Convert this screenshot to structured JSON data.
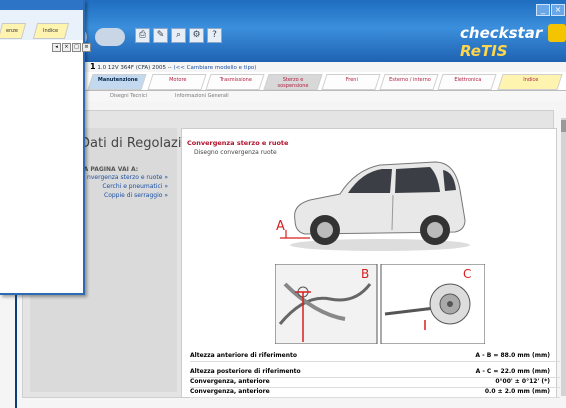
{
  "app": {
    "logo_text": "checkstar",
    "logo_suffix": "ReTIS",
    "vehicle_model": "1",
    "vehicle_desc": "1.0 12V 364F (CFA) 2005 --",
    "change_link": "(<< Cambiare modello e tipo)"
  },
  "main_tabs": [
    {
      "label": "Manutenzione",
      "state": "active"
    },
    {
      "label": "Motore",
      "state": "normal"
    },
    {
      "label": "Trasmissione",
      "state": "normal"
    },
    {
      "label": "Sterzo e sospensione",
      "state": "gray"
    },
    {
      "label": "Freni",
      "state": "normal"
    },
    {
      "label": "Esterno / interno",
      "state": "normal"
    },
    {
      "label": "Elettronica",
      "state": "normal"
    },
    {
      "label": "Indice",
      "state": "last"
    }
  ],
  "sub_tabs": [
    "Disegni Tecnici",
    "Informazioni Generali"
  ],
  "left_panel": {
    "heading": "Dati di Regolazione",
    "vai_title": "TA PAGINA VAI A:",
    "links": [
      "nvergenza sterzo e ruote »",
      "Cerchi e pneumatici »",
      "Coppie di serraggio »"
    ]
  },
  "main_panel": {
    "section_title": "Convergenza sterzo e ruote",
    "section_subtitle": "Disegno convergenza ruote",
    "image_labels": {
      "a": "A",
      "b": "B",
      "c": "C"
    },
    "specs": [
      {
        "label": "Altezza anteriore di riferimento",
        "value": "A - B = 88.0 mm (mm)"
      },
      {
        "label": "Altezza posteriore di riferimento",
        "value": "A - C = 22.0 mm (mm)"
      },
      {
        "label": "Convergenza, anteriore",
        "value": "0°00' ± 0°12' (*)"
      },
      {
        "label": "Convergenza, anteriore",
        "value": "0.0 ± 2.0 mm (mm)"
      }
    ]
  },
  "popup": {
    "title": "",
    "tabs": [
      "enze",
      "Indice"
    ]
  },
  "colors": {
    "title_blue": "#2e74c6",
    "tab_active": "#c3d9ef",
    "tab_last": "#fff3b0",
    "link_blue": "#1b4fa3",
    "section_red": "#b0102a"
  }
}
